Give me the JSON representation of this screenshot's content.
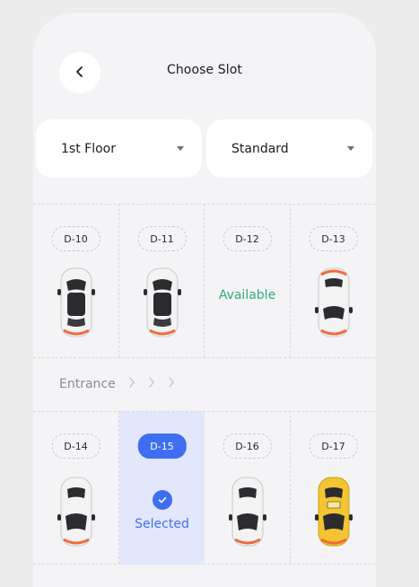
{
  "header": {
    "title": "Choose Slot",
    "back_icon": "chevron-left-icon"
  },
  "filters": {
    "floor": {
      "selected": "1st Floor",
      "icon": "caret-down-icon"
    },
    "type": {
      "selected": "Standard",
      "icon": "caret-down-icon"
    }
  },
  "entrance": {
    "label": "Entrance"
  },
  "slots": [
    {
      "id": "D-10",
      "state": "occupied",
      "car_color": "white"
    },
    {
      "id": "D-11",
      "state": "occupied",
      "car_color": "white"
    },
    {
      "id": "D-12",
      "state": "available",
      "status_text": "Available"
    },
    {
      "id": "D-13",
      "state": "occupied",
      "car_color": "white"
    },
    {
      "id": "D-14",
      "state": "occupied",
      "car_color": "white"
    },
    {
      "id": "D-15",
      "state": "selected",
      "status_text": "Selected"
    },
    {
      "id": "D-16",
      "state": "occupied",
      "car_color": "white"
    },
    {
      "id": "D-17",
      "state": "occupied",
      "car_color": "yellow"
    }
  ],
  "colors": {
    "accent": "#3f6ff0",
    "available": "#2fae74",
    "selected_bg": "#e3e7fb",
    "car_white": "#f3f3f3",
    "car_yellow": "#f3c531"
  }
}
